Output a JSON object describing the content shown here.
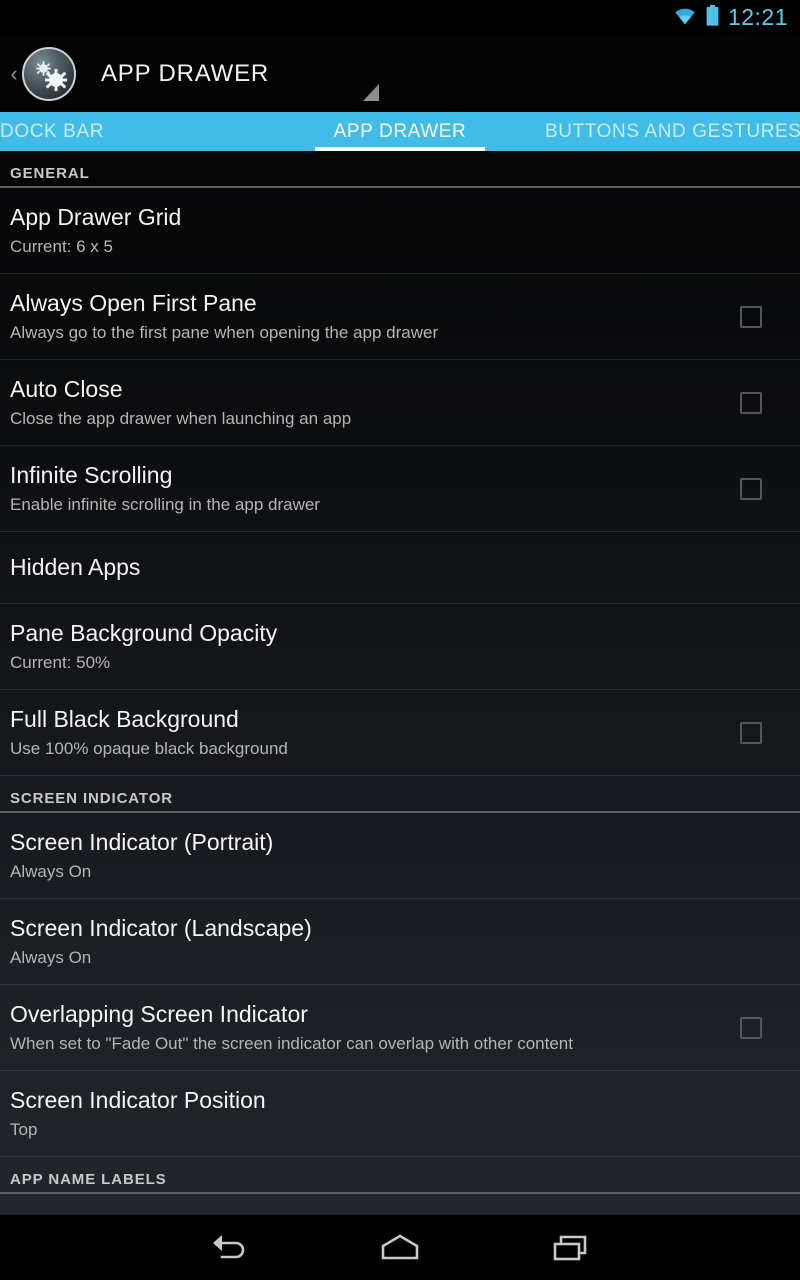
{
  "status_bar": {
    "time": "12:21",
    "wifi_icon": "wifi-icon",
    "battery_icon": "battery-icon",
    "accent_color": "#62c8ea"
  },
  "action_bar": {
    "title": "APP DRAWER",
    "up_caret": "‹",
    "app_icon": "nova-settings-gear-icon",
    "overflow_caret": "dropdown-caret-icon"
  },
  "tab_bar": {
    "background_color": "#41bbe8",
    "active_index": 1,
    "tabs": [
      {
        "label": "DOCK BAR",
        "active": false
      },
      {
        "label": "APP DRAWER",
        "active": true
      },
      {
        "label": "BUTTONS AND GESTURES",
        "active": false
      }
    ]
  },
  "list": [
    {
      "kind": "section",
      "label": "GENERAL"
    },
    {
      "kind": "row",
      "title": "App Drawer Grid",
      "summary": "Current: 6 x 5",
      "checkbox": false
    },
    {
      "kind": "row",
      "title": "Always Open First Pane",
      "summary": "Always go to the first pane when opening the app drawer",
      "checkbox": true,
      "checked": false
    },
    {
      "kind": "row",
      "title": "Auto Close",
      "summary": "Close the app drawer when launching an app",
      "checkbox": true,
      "checked": false
    },
    {
      "kind": "row",
      "title": "Infinite Scrolling",
      "summary": "Enable infinite scrolling in the app drawer",
      "checkbox": true,
      "checked": false
    },
    {
      "kind": "row",
      "title": "Hidden Apps",
      "summary": "",
      "checkbox": false
    },
    {
      "kind": "row",
      "title": "Pane Background Opacity",
      "summary": "Current: 50%",
      "checkbox": false
    },
    {
      "kind": "row",
      "title": "Full Black Background",
      "summary": "Use 100% opaque black background",
      "checkbox": true,
      "checked": false
    },
    {
      "kind": "section",
      "label": "SCREEN INDICATOR"
    },
    {
      "kind": "row",
      "title": "Screen Indicator (Portrait)",
      "summary": "Always On",
      "checkbox": false
    },
    {
      "kind": "row",
      "title": "Screen Indicator (Landscape)",
      "summary": "Always On",
      "checkbox": false
    },
    {
      "kind": "row",
      "title": "Overlapping Screen Indicator",
      "summary": "When set to \"Fade Out\" the screen indicator can overlap with other content",
      "checkbox": true,
      "checked": false
    },
    {
      "kind": "row",
      "title": "Screen Indicator Position",
      "summary": "Top",
      "checkbox": false
    },
    {
      "kind": "section",
      "label": "APP NAME LABELS"
    }
  ],
  "nav_bar": {
    "buttons": [
      {
        "name": "back-icon",
        "label": "Back"
      },
      {
        "name": "home-icon",
        "label": "Home"
      },
      {
        "name": "recents-icon",
        "label": "Recent apps"
      }
    ]
  }
}
